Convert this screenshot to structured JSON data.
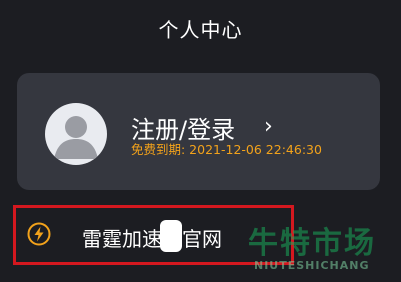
{
  "header": {
    "title": "个人中心"
  },
  "profile": {
    "login_label": "注册/登录",
    "chevron": "›",
    "expiry_text": "免费到期: 2021-12-06 22:46:30"
  },
  "site_row": {
    "label": "雷霆加速　官网",
    "icon": "lightning-icon"
  },
  "watermark": {
    "text": "牛特市场",
    "sub": "NIUTESHICHANG"
  },
  "colors": {
    "background": "#1c1d22",
    "card": "#35373f",
    "accent": "#f2a21b",
    "highlight": "#d4181f",
    "watermark": "#19a85a"
  }
}
